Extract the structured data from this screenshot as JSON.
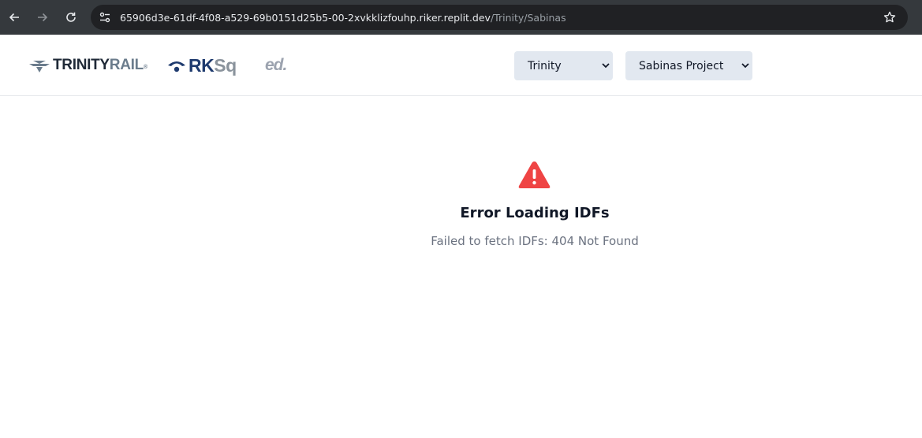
{
  "browser": {
    "url_host": "65906d3e-61df-4f08-a529-69b0151d25b5-00-2xvkklizfouhp.riker.replit.dev",
    "url_path": "/Trinity/Sabinas",
    "icons": [
      "back-arrow-icon",
      "forward-arrow-icon",
      "reload-icon",
      "site-settings-icon",
      "bookmark-star-icon"
    ]
  },
  "header": {
    "logos": {
      "trinity_main": "TRINITY",
      "trinity_accent": "RAIL",
      "trinity_mark": "®",
      "rksq_main": "RK",
      "rksq_accent": "Sq",
      "ed": "ed."
    },
    "client_select": {
      "value": "Trinity"
    },
    "project_select": {
      "value": "Sabinas Project"
    }
  },
  "error": {
    "title": "Error Loading IDFs",
    "message": "Failed to fetch IDFs: 404 Not Found",
    "icon": "warning-triangle-icon"
  },
  "colors": {
    "chrome": "#35393d",
    "address_bg": "#202124",
    "warning_red": "#ef4444",
    "select_bg": "#e2e8f0",
    "rksq_blue": "#1e3a6e"
  }
}
